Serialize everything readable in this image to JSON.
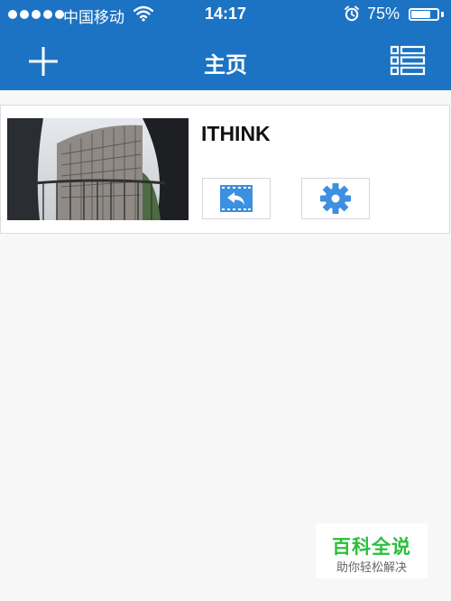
{
  "status_bar": {
    "carrier": "中国移动",
    "time": "14:17",
    "battery_percent": "75%",
    "battery_level": 0.75,
    "signal_icon": "signal-dots-icon",
    "wifi_icon": "wifi-icon",
    "alarm_icon": "alarm-clock-icon"
  },
  "navbar": {
    "title": "主页",
    "left_icon": "plus-icon",
    "right_icon": "list-icon",
    "background_color": "#1c73c3"
  },
  "devices": [
    {
      "name": "ITHINK",
      "thumbnail": "fisheye-building-photo",
      "playback_icon": "playback-icon",
      "settings_icon": "gear-icon",
      "accent_color": "#3d8fe0"
    }
  ],
  "watermark": {
    "title": "百科全说",
    "subtitle": "助你轻松解决",
    "color": "#2bbf3c"
  }
}
